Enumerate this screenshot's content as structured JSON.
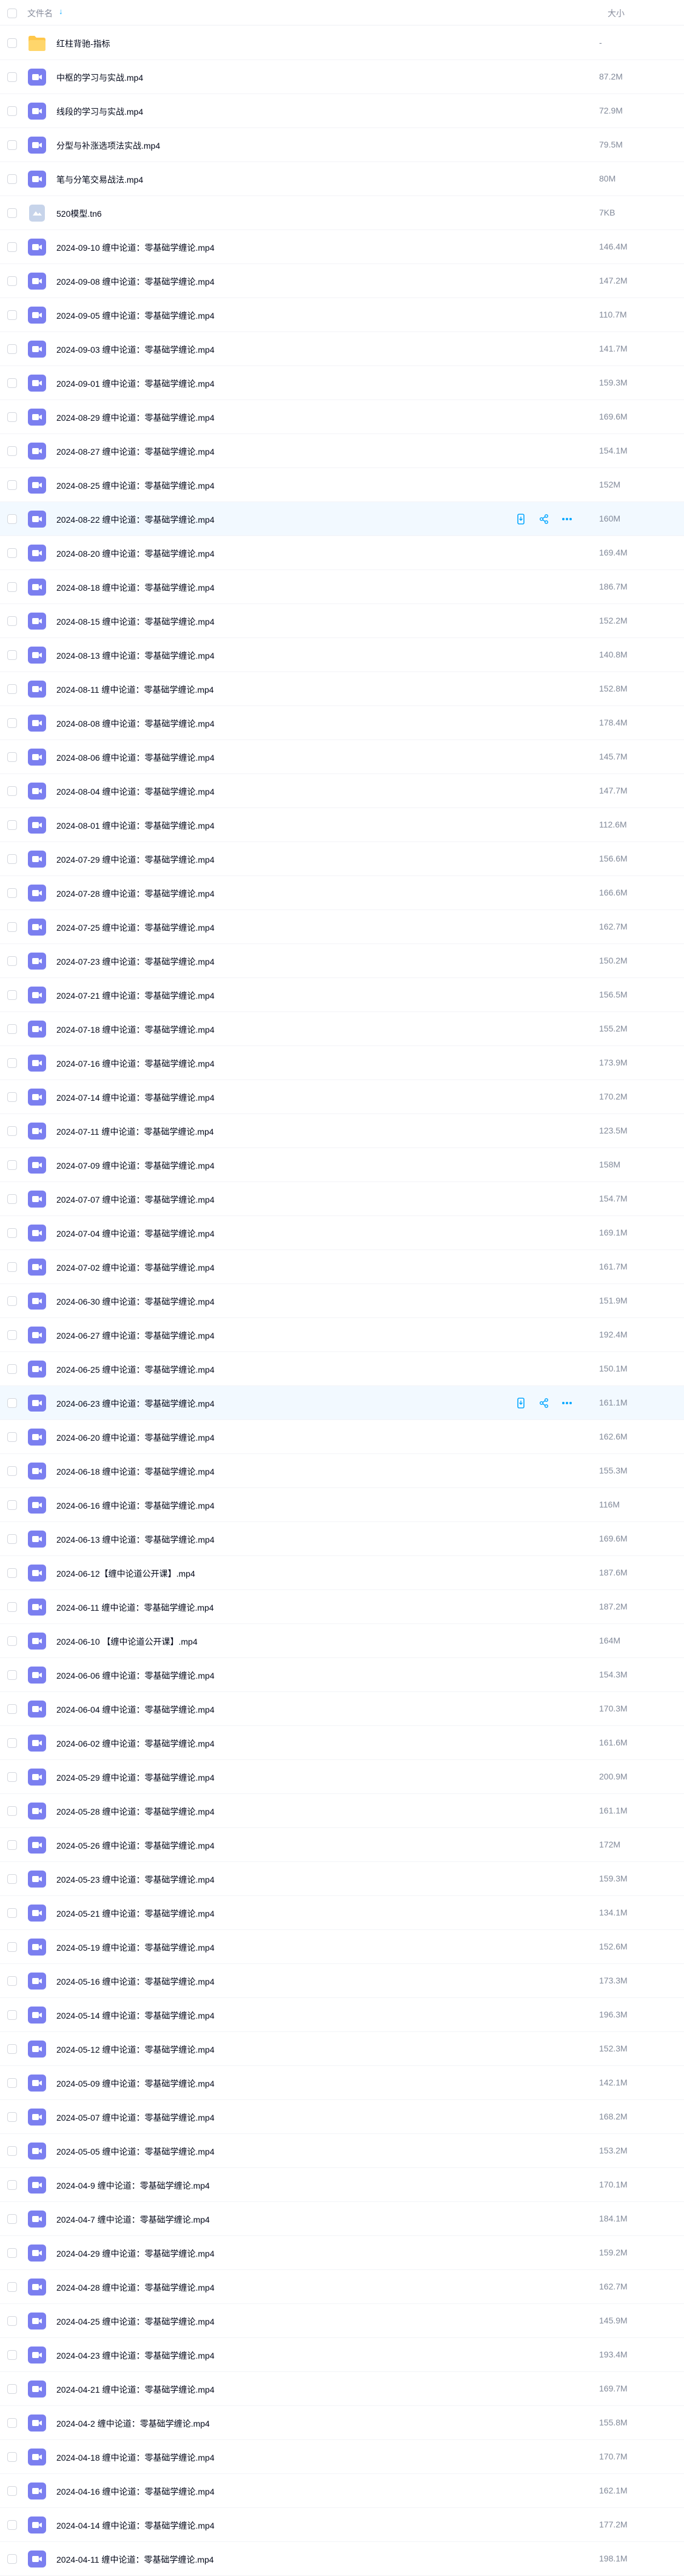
{
  "header": {
    "name_label": "文件名",
    "sort_icon": "arrow-down-icon",
    "size_label": "大小"
  },
  "colors": {
    "video_icon": "#7b7ff0",
    "folder_icon": "#ffc74a",
    "hover_row": "#f2f9ff",
    "action_icon": "#06a7ff"
  },
  "files": [
    {
      "name": "红柱背驰-指标",
      "size": "-",
      "type": "folder"
    },
    {
      "name": "中枢的学习与实战.mp4",
      "size": "87.2M",
      "type": "video"
    },
    {
      "name": "线段的学习与实战.mp4",
      "size": "72.9M",
      "type": "video"
    },
    {
      "name": "分型与补涨选项法实战.mp4",
      "size": "79.5M",
      "type": "video"
    },
    {
      "name": "笔与分笔交易战法.mp4",
      "size": "80M",
      "type": "video"
    },
    {
      "name": "520模型.tn6",
      "size": "7KB",
      "type": "file"
    },
    {
      "name": "2024-09-10 缠中论道：零基础学缠论.mp4",
      "size": "146.4M",
      "type": "video"
    },
    {
      "name": "2024-09-08 缠中论道：零基础学缠论.mp4",
      "size": "147.2M",
      "type": "video"
    },
    {
      "name": "2024-09-05 缠中论道：零基础学缠论.mp4",
      "size": "110.7M",
      "type": "video"
    },
    {
      "name": "2024-09-03 缠中论道：零基础学缠论.mp4",
      "size": "141.7M",
      "type": "video"
    },
    {
      "name": "2024-09-01 缠中论道：零基础学缠论.mp4",
      "size": "159.3M",
      "type": "video"
    },
    {
      "name": "2024-08-29 缠中论道：零基础学缠论.mp4",
      "size": "169.6M",
      "type": "video"
    },
    {
      "name": "2024-08-27 缠中论道：零基础学缠论.mp4",
      "size": "154.1M",
      "type": "video"
    },
    {
      "name": "2024-08-25 缠中论道：零基础学缠论.mp4",
      "size": "152M",
      "type": "video"
    },
    {
      "name": "2024-08-22 缠中论道：零基础学缠论.mp4",
      "size": "160M",
      "type": "video",
      "hover": true
    },
    {
      "name": "2024-08-20 缠中论道：零基础学缠论.mp4",
      "size": "169.4M",
      "type": "video"
    },
    {
      "name": "2024-08-18 缠中论道：零基础学缠论.mp4",
      "size": "186.7M",
      "type": "video"
    },
    {
      "name": "2024-08-15 缠中论道：零基础学缠论.mp4",
      "size": "152.2M",
      "type": "video"
    },
    {
      "name": "2024-08-13 缠中论道：零基础学缠论.mp4",
      "size": "140.8M",
      "type": "video"
    },
    {
      "name": "2024-08-11 缠中论道：零基础学缠论.mp4",
      "size": "152.8M",
      "type": "video"
    },
    {
      "name": "2024-08-08 缠中论道：零基础学缠论.mp4",
      "size": "178.4M",
      "type": "video"
    },
    {
      "name": "2024-08-06 缠中论道：零基础学缠论.mp4",
      "size": "145.7M",
      "type": "video"
    },
    {
      "name": "2024-08-04 缠中论道：零基础学缠论.mp4",
      "size": "147.7M",
      "type": "video"
    },
    {
      "name": "2024-08-01 缠中论道：零基础学缠论.mp4",
      "size": "112.6M",
      "type": "video"
    },
    {
      "name": "2024-07-29 缠中论道：零基础学缠论.mp4",
      "size": "156.6M",
      "type": "video"
    },
    {
      "name": "2024-07-28 缠中论道：零基础学缠论.mp4",
      "size": "166.6M",
      "type": "video"
    },
    {
      "name": "2024-07-25 缠中论道：零基础学缠论.mp4",
      "size": "162.7M",
      "type": "video"
    },
    {
      "name": "2024-07-23 缠中论道：零基础学缠论.mp4",
      "size": "150.2M",
      "type": "video"
    },
    {
      "name": "2024-07-21 缠中论道：零基础学缠论.mp4",
      "size": "156.5M",
      "type": "video"
    },
    {
      "name": "2024-07-18 缠中论道：零基础学缠论.mp4",
      "size": "155.2M",
      "type": "video"
    },
    {
      "name": "2024-07-16 缠中论道：零基础学缠论.mp4",
      "size": "173.9M",
      "type": "video"
    },
    {
      "name": "2024-07-14 缠中论道：零基础学缠论.mp4",
      "size": "170.2M",
      "type": "video"
    },
    {
      "name": "2024-07-11 缠中论道：零基础学缠论.mp4",
      "size": "123.5M",
      "type": "video"
    },
    {
      "name": "2024-07-09 缠中论道：零基础学缠论.mp4",
      "size": "158M",
      "type": "video"
    },
    {
      "name": "2024-07-07 缠中论道：零基础学缠论.mp4",
      "size": "154.7M",
      "type": "video"
    },
    {
      "name": "2024-07-04 缠中论道：零基础学缠论.mp4",
      "size": "169.1M",
      "type": "video"
    },
    {
      "name": "2024-07-02 缠中论道：零基础学缠论.mp4",
      "size": "161.7M",
      "type": "video"
    },
    {
      "name": "2024-06-30 缠中论道：零基础学缠论.mp4",
      "size": "151.9M",
      "type": "video"
    },
    {
      "name": "2024-06-27 缠中论道：零基础学缠论.mp4",
      "size": "192.4M",
      "type": "video"
    },
    {
      "name": "2024-06-25 缠中论道：零基础学缠论.mp4",
      "size": "150.1M",
      "type": "video"
    },
    {
      "name": "2024-06-23 缠中论道：零基础学缠论.mp4",
      "size": "161.1M",
      "type": "video",
      "hover": true
    },
    {
      "name": "2024-06-20 缠中论道：零基础学缠论.mp4",
      "size": "162.6M",
      "type": "video"
    },
    {
      "name": "2024-06-18 缠中论道：零基础学缠论.mp4",
      "size": "155.3M",
      "type": "video"
    },
    {
      "name": "2024-06-16 缠中论道：零基础学缠论.mp4",
      "size": "116M",
      "type": "video"
    },
    {
      "name": "2024-06-13 缠中论道：零基础学缠论.mp4",
      "size": "169.6M",
      "type": "video"
    },
    {
      "name": "2024-06-12【缠中论道公开课】.mp4",
      "size": "187.6M",
      "type": "video"
    },
    {
      "name": "2024-06-11 缠中论道：零基础学缠论.mp4",
      "size": "187.2M",
      "type": "video"
    },
    {
      "name": "2024-06-10 【缠中论道公开课】.mp4",
      "size": "164M",
      "type": "video"
    },
    {
      "name": "2024-06-06 缠中论道：零基础学缠论.mp4",
      "size": "154.3M",
      "type": "video"
    },
    {
      "name": "2024-06-04 缠中论道：零基础学缠论.mp4",
      "size": "170.3M",
      "type": "video"
    },
    {
      "name": "2024-06-02 缠中论道：零基础学缠论.mp4",
      "size": "161.6M",
      "type": "video"
    },
    {
      "name": "2024-05-29 缠中论道：零基础学缠论.mp4",
      "size": "200.9M",
      "type": "video"
    },
    {
      "name": "2024-05-28 缠中论道：零基础学缠论.mp4",
      "size": "161.1M",
      "type": "video"
    },
    {
      "name": "2024-05-26 缠中论道：零基础学缠论.mp4",
      "size": "172M",
      "type": "video"
    },
    {
      "name": "2024-05-23 缠中论道：零基础学缠论.mp4",
      "size": "159.3M",
      "type": "video"
    },
    {
      "name": "2024-05-21 缠中论道：零基础学缠论.mp4",
      "size": "134.1M",
      "type": "video"
    },
    {
      "name": "2024-05-19 缠中论道：零基础学缠论.mp4",
      "size": "152.6M",
      "type": "video"
    },
    {
      "name": "2024-05-16 缠中论道：零基础学缠论.mp4",
      "size": "173.3M",
      "type": "video"
    },
    {
      "name": "2024-05-14 缠中论道：零基础学缠论.mp4",
      "size": "196.3M",
      "type": "video"
    },
    {
      "name": "2024-05-12 缠中论道：零基础学缠论.mp4",
      "size": "152.3M",
      "type": "video"
    },
    {
      "name": "2024-05-09 缠中论道：零基础学缠论.mp4",
      "size": "142.1M",
      "type": "video"
    },
    {
      "name": "2024-05-07 缠中论道：零基础学缠论.mp4",
      "size": "168.2M",
      "type": "video"
    },
    {
      "name": "2024-05-05 缠中论道：零基础学缠论.mp4",
      "size": "153.2M",
      "type": "video"
    },
    {
      "name": "2024-04-9 缠中论道：零基础学缠论.mp4",
      "size": "170.1M",
      "type": "video"
    },
    {
      "name": "2024-04-7 缠中论道：零基础学缠论.mp4",
      "size": "184.1M",
      "type": "video"
    },
    {
      "name": "2024-04-29 缠中论道：零基础学缠论.mp4",
      "size": "159.2M",
      "type": "video"
    },
    {
      "name": "2024-04-28 缠中论道：零基础学缠论.mp4",
      "size": "162.7M",
      "type": "video"
    },
    {
      "name": "2024-04-25 缠中论道：零基础学缠论.mp4",
      "size": "145.9M",
      "type": "video"
    },
    {
      "name": "2024-04-23 缠中论道：零基础学缠论.mp4",
      "size": "193.4M",
      "type": "video"
    },
    {
      "name": "2024-04-21 缠中论道：零基础学缠论.mp4",
      "size": "169.7M",
      "type": "video"
    },
    {
      "name": "2024-04-2 缠中论道：零基础学缠论.mp4",
      "size": "155.8M",
      "type": "video"
    },
    {
      "name": "2024-04-18 缠中论道：零基础学缠论.mp4",
      "size": "170.7M",
      "type": "video"
    },
    {
      "name": "2024-04-16 缠中论道：零基础学缠论.mp4",
      "size": "162.1M",
      "type": "video"
    },
    {
      "name": "2024-04-14 缠中论道：零基础学缠论.mp4",
      "size": "177.2M",
      "type": "video"
    },
    {
      "name": "2024-04-11 缠中论道：零基础学缠论.mp4",
      "size": "198.1M",
      "type": "video"
    }
  ],
  "row_actions": [
    {
      "icon": "phone-save-icon",
      "name": "save-to-phone-button"
    },
    {
      "icon": "share-icon",
      "name": "share-button"
    },
    {
      "icon": "more-icon",
      "name": "more-button"
    }
  ]
}
